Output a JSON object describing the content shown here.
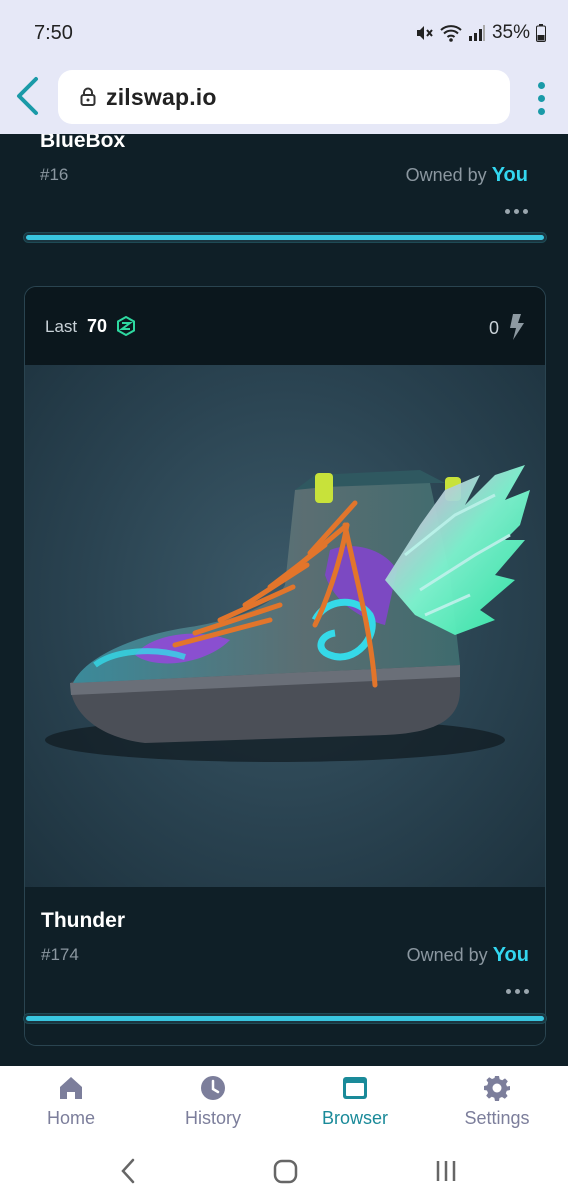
{
  "status_bar": {
    "time": "7:50",
    "battery": "35%"
  },
  "browser": {
    "url": "zilswap.io",
    "accent": "#1a9aa8"
  },
  "previous_card": {
    "name": "BlueBox",
    "id": "#16",
    "owned_by_label": "Owned by",
    "owner": "You"
  },
  "card": {
    "last_label": "Last",
    "last_value": "70",
    "likes": "0",
    "name": "Thunder",
    "id": "#174",
    "owned_by_label": "Owned by",
    "owner": "You"
  },
  "bottom_nav": {
    "items": [
      {
        "label": "Home",
        "icon": "home-icon"
      },
      {
        "label": "History",
        "icon": "clock-icon"
      },
      {
        "label": "Browser",
        "icon": "browser-icon",
        "active": true
      },
      {
        "label": "Settings",
        "icon": "gear-icon"
      }
    ]
  },
  "colors": {
    "accent_cyan": "#33d7f0",
    "nav_active": "#1a8a99",
    "nav_inactive": "#7c7e9b",
    "page_bg": "#0f1f27"
  }
}
